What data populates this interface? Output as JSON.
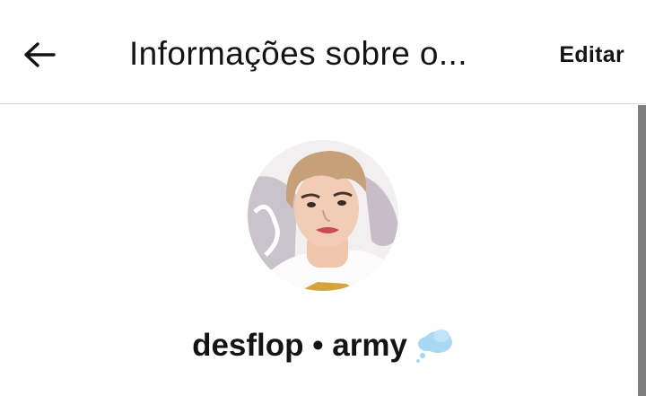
{
  "header": {
    "back_icon": "arrow-left-icon",
    "title": "Informações sobre o...",
    "edit_label": "Editar"
  },
  "profile": {
    "avatar_icon": "profile-photo",
    "display_name": "desflop • army",
    "name_emoji_icon": "thought-balloon-icon"
  },
  "colors": {
    "text": "#141414",
    "divider": "#d9d9d9",
    "scrollbar": "#7f7f7f",
    "emoji": "#a9d8f2"
  }
}
